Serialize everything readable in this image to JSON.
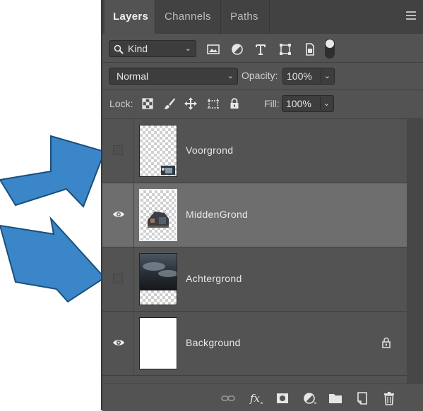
{
  "panel": {
    "tabs": [
      {
        "label": "Layers",
        "active": true
      },
      {
        "label": "Channels",
        "active": false
      },
      {
        "label": "Paths",
        "active": false
      }
    ],
    "menu_icon": "hamburger-menu-icon"
  },
  "filter": {
    "kind_label": "Kind",
    "icons": [
      "image-filter-icon",
      "adjustment-filter-icon",
      "type-filter-icon",
      "shape-filter-icon",
      "smart-object-filter-icon"
    ]
  },
  "blend": {
    "mode": "Normal",
    "opacity_label": "Opacity:",
    "opacity_value": "100%"
  },
  "lock_row": {
    "lock_label": "Lock:",
    "fill_label": "Fill:",
    "fill_value": "100%",
    "icons": [
      "lock-transparent-pixels-icon",
      "lock-image-pixels-icon",
      "lock-position-icon",
      "lock-artboard-icon",
      "lock-all-icon"
    ]
  },
  "layers": [
    {
      "name": "Voorgrond",
      "visible": false,
      "selected": false,
      "thumb": "transparent-with-small-image"
    },
    {
      "name": "MiddenGrond",
      "visible": true,
      "selected": true,
      "thumb": "transparent-with-house"
    },
    {
      "name": "Achtergrond",
      "visible": false,
      "selected": false,
      "thumb": "clouds"
    },
    {
      "name": "Background",
      "visible": true,
      "selected": false,
      "thumb": "white",
      "locked": true
    }
  ],
  "bottom_icons": [
    "link-layers-icon",
    "fx-icon",
    "layer-mask-icon",
    "adjustment-layer-icon",
    "new-group-icon",
    "new-layer-icon",
    "delete-icon"
  ],
  "colors": {
    "panel_bg": "#535353",
    "selected_row": "#6e6e6e",
    "arrow_blue": "#3a86c8"
  }
}
